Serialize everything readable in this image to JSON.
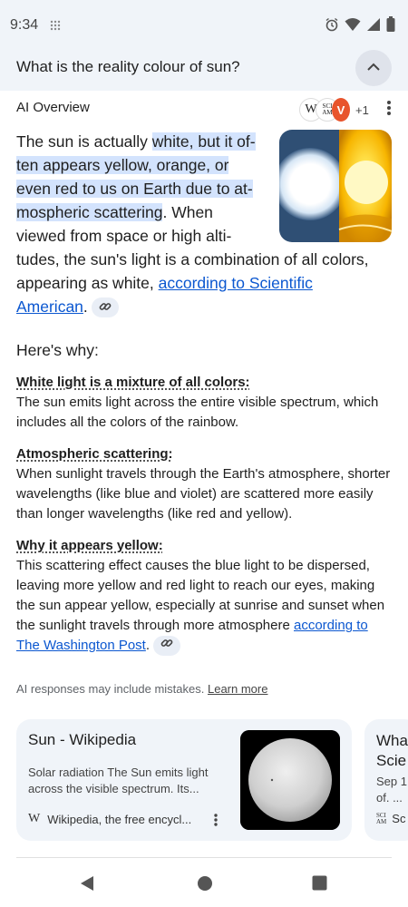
{
  "status": {
    "time": "9:34"
  },
  "question": "What is the reality colour of sun?",
  "ai_overview": {
    "title": "AI Overview",
    "sources_plus": "+1",
    "lead_intro": "The sun is actually ",
    "lead_highlight_1": "white, but it of-",
    "lead_highlight_2": "ten appears yellow, orange, or",
    "lead_highlight_3": "even red to us on Earth due to at-",
    "lead_highlight_4": "mospheric scattering",
    "lead_rest_1": ". When",
    "lead_rest_2": "viewed from space or high alti-",
    "lead_rest_3": "tudes, the sun's light is a combination of all colors,",
    "lead_rest_4": "appearing as white, ",
    "lead_link": "according to Scientific American",
    "lead_end": ".",
    "why_heading": "Here's why:",
    "sections": [
      {
        "title": "White light is a mixture of all colors:",
        "body": "The sun emits light across the entire visible spectrum, which includes all the colors of the rainbow."
      },
      {
        "title": "Atmospheric scattering:",
        "body": "When sunlight travels through the Earth's atmosphere, shorter wavelengths (like blue and violet) are scattered more easily than longer wavelengths (like red and yellow)."
      },
      {
        "title": "Why it appears yellow:",
        "body": "This scattering effect causes the blue light to be dispersed, leaving more yellow and red light to reach our eyes, making the sun appear yellow, especially at sunrise and sunset when the sunlight travels through more atmosphere ",
        "link": "according to The Washington Post",
        "end": "."
      }
    ],
    "disclaimer": "AI responses may include mistakes. ",
    "learn_more": "Learn more"
  },
  "cards": [
    {
      "title": "Sun - Wikipedia",
      "snippet": "Solar radiation The Sun emits light across the visible spectrum. Its...",
      "source": "Wikipedia, the free encycl..."
    },
    {
      "title": "Wha Scie",
      "snippet_1": "Sep 1,",
      "snippet_2": "of. ...",
      "source": "Sc"
    }
  ],
  "colors": {
    "accent_link": "#0b57d0",
    "highlight": "#d3e3fd",
    "surface": "#f0f4f9"
  }
}
